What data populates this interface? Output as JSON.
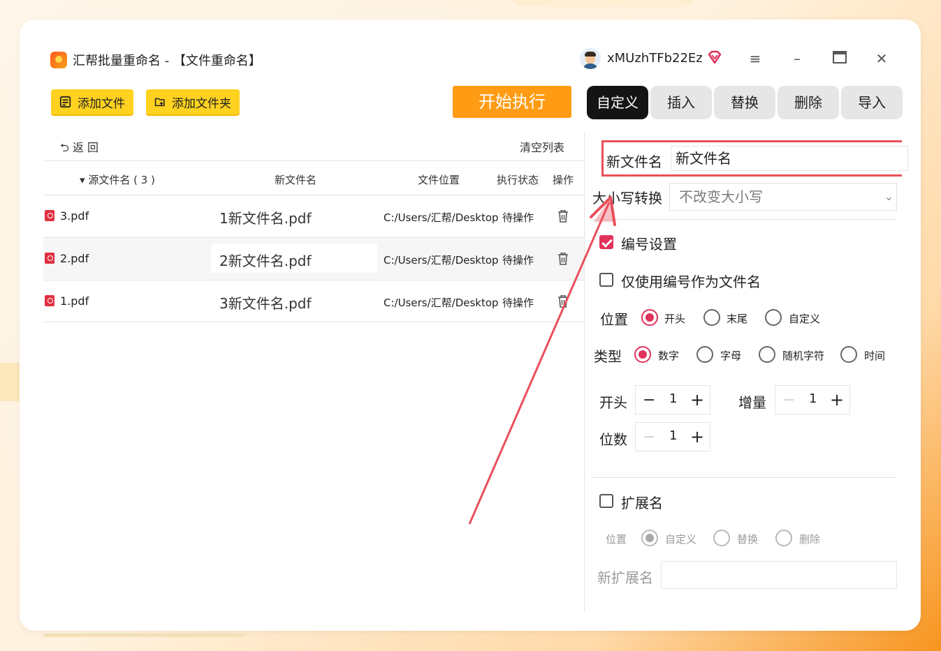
{
  "app": {
    "title": "汇帮批量重命名 - 【文件重命名】",
    "username": "xMUzhTFb22Ez"
  },
  "toolbar": {
    "add_file": "添加文件",
    "add_folder": "添加文件夹",
    "start": "开始执行"
  },
  "tabs": [
    "自定义",
    "插入",
    "替换",
    "删除",
    "导入"
  ],
  "list": {
    "back": "返 回",
    "clear": "清空列表",
    "headers": {
      "source": "源文件名 ( 3 )",
      "new_name": "新文件名",
      "location": "文件位置",
      "status": "执行状态",
      "action": "操作"
    },
    "rows": [
      {
        "source": "3.pdf",
        "new_name": "1新文件名.pdf",
        "location": "C:/Users/汇帮/Desktop",
        "status": "待操作"
      },
      {
        "source": "2.pdf",
        "new_name": "2新文件名.pdf",
        "location": "C:/Users/汇帮/Desktop",
        "status": "待操作"
      },
      {
        "source": "1.pdf",
        "new_name": "3新文件名.pdf",
        "location": "C:/Users/汇帮/Desktop",
        "status": "待操作"
      }
    ]
  },
  "panel": {
    "new_name_label": "新文件名",
    "new_name_value": "新文件名",
    "case_label": "大小写转换",
    "case_value": "不改变大小写",
    "numbering_label": "编号设置",
    "numbering_checked": true,
    "only_number_label": "仅使用编号作为文件名",
    "only_number_checked": false,
    "position_label": "位置",
    "position_options": [
      "开头",
      "末尾",
      "自定义"
    ],
    "position_selected": "开头",
    "type_label": "类型",
    "type_options": [
      "数字",
      "字母",
      "随机字符",
      "时间"
    ],
    "type_selected": "数字",
    "start_label": "开头",
    "start_value": "1",
    "increment_label": "增量",
    "increment_value": "1",
    "digits_label": "位数",
    "digits_value": "1",
    "ext_label": "扩展名",
    "ext_checked": false,
    "ext_position_label": "位置",
    "ext_position_options": [
      "自定义",
      "替换",
      "删除"
    ],
    "ext_position_selected": "自定义",
    "new_ext_label": "新扩展名",
    "new_ext_value": ""
  },
  "colors": {
    "accent": "#e0325b",
    "start_button": "#ff9c14",
    "yellow_button": "#ffd21f",
    "annotation": "#e8505b"
  }
}
